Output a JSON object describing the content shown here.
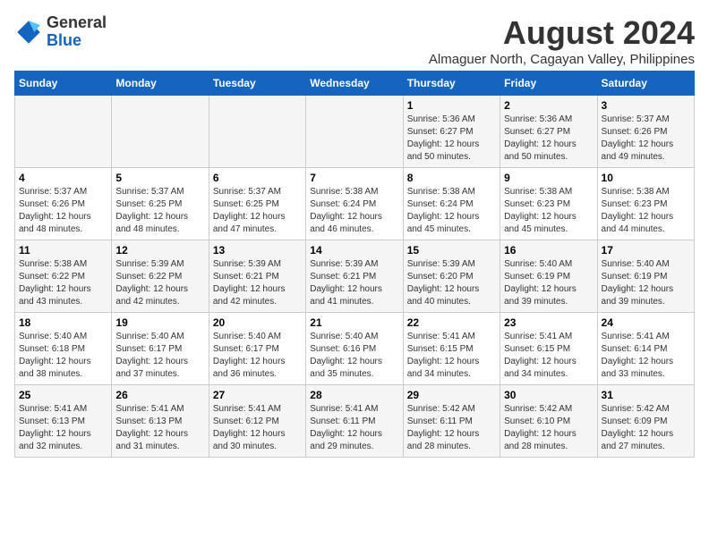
{
  "header": {
    "logo_general": "General",
    "logo_blue": "Blue",
    "main_title": "August 2024",
    "subtitle": "Almaguer North, Cagayan Valley, Philippines"
  },
  "days_of_week": [
    "Sunday",
    "Monday",
    "Tuesday",
    "Wednesday",
    "Thursday",
    "Friday",
    "Saturday"
  ],
  "weeks": [
    [
      {
        "day": "",
        "sunrise": "",
        "sunset": "",
        "daylight": ""
      },
      {
        "day": "",
        "sunrise": "",
        "sunset": "",
        "daylight": ""
      },
      {
        "day": "",
        "sunrise": "",
        "sunset": "",
        "daylight": ""
      },
      {
        "day": "",
        "sunrise": "",
        "sunset": "",
        "daylight": ""
      },
      {
        "day": "1",
        "sunrise": "Sunrise: 5:36 AM",
        "sunset": "Sunset: 6:27 PM",
        "daylight": "Daylight: 12 hours and 50 minutes."
      },
      {
        "day": "2",
        "sunrise": "Sunrise: 5:36 AM",
        "sunset": "Sunset: 6:27 PM",
        "daylight": "Daylight: 12 hours and 50 minutes."
      },
      {
        "day": "3",
        "sunrise": "Sunrise: 5:37 AM",
        "sunset": "Sunset: 6:26 PM",
        "daylight": "Daylight: 12 hours and 49 minutes."
      }
    ],
    [
      {
        "day": "4",
        "sunrise": "Sunrise: 5:37 AM",
        "sunset": "Sunset: 6:26 PM",
        "daylight": "Daylight: 12 hours and 48 minutes."
      },
      {
        "day": "5",
        "sunrise": "Sunrise: 5:37 AM",
        "sunset": "Sunset: 6:25 PM",
        "daylight": "Daylight: 12 hours and 48 minutes."
      },
      {
        "day": "6",
        "sunrise": "Sunrise: 5:37 AM",
        "sunset": "Sunset: 6:25 PM",
        "daylight": "Daylight: 12 hours and 47 minutes."
      },
      {
        "day": "7",
        "sunrise": "Sunrise: 5:38 AM",
        "sunset": "Sunset: 6:24 PM",
        "daylight": "Daylight: 12 hours and 46 minutes."
      },
      {
        "day": "8",
        "sunrise": "Sunrise: 5:38 AM",
        "sunset": "Sunset: 6:24 PM",
        "daylight": "Daylight: 12 hours and 45 minutes."
      },
      {
        "day": "9",
        "sunrise": "Sunrise: 5:38 AM",
        "sunset": "Sunset: 6:23 PM",
        "daylight": "Daylight: 12 hours and 45 minutes."
      },
      {
        "day": "10",
        "sunrise": "Sunrise: 5:38 AM",
        "sunset": "Sunset: 6:23 PM",
        "daylight": "Daylight: 12 hours and 44 minutes."
      }
    ],
    [
      {
        "day": "11",
        "sunrise": "Sunrise: 5:38 AM",
        "sunset": "Sunset: 6:22 PM",
        "daylight": "Daylight: 12 hours and 43 minutes."
      },
      {
        "day": "12",
        "sunrise": "Sunrise: 5:39 AM",
        "sunset": "Sunset: 6:22 PM",
        "daylight": "Daylight: 12 hours and 42 minutes."
      },
      {
        "day": "13",
        "sunrise": "Sunrise: 5:39 AM",
        "sunset": "Sunset: 6:21 PM",
        "daylight": "Daylight: 12 hours and 42 minutes."
      },
      {
        "day": "14",
        "sunrise": "Sunrise: 5:39 AM",
        "sunset": "Sunset: 6:21 PM",
        "daylight": "Daylight: 12 hours and 41 minutes."
      },
      {
        "day": "15",
        "sunrise": "Sunrise: 5:39 AM",
        "sunset": "Sunset: 6:20 PM",
        "daylight": "Daylight: 12 hours and 40 minutes."
      },
      {
        "day": "16",
        "sunrise": "Sunrise: 5:40 AM",
        "sunset": "Sunset: 6:19 PM",
        "daylight": "Daylight: 12 hours and 39 minutes."
      },
      {
        "day": "17",
        "sunrise": "Sunrise: 5:40 AM",
        "sunset": "Sunset: 6:19 PM",
        "daylight": "Daylight: 12 hours and 39 minutes."
      }
    ],
    [
      {
        "day": "18",
        "sunrise": "Sunrise: 5:40 AM",
        "sunset": "Sunset: 6:18 PM",
        "daylight": "Daylight: 12 hours and 38 minutes."
      },
      {
        "day": "19",
        "sunrise": "Sunrise: 5:40 AM",
        "sunset": "Sunset: 6:17 PM",
        "daylight": "Daylight: 12 hours and 37 minutes."
      },
      {
        "day": "20",
        "sunrise": "Sunrise: 5:40 AM",
        "sunset": "Sunset: 6:17 PM",
        "daylight": "Daylight: 12 hours and 36 minutes."
      },
      {
        "day": "21",
        "sunrise": "Sunrise: 5:40 AM",
        "sunset": "Sunset: 6:16 PM",
        "daylight": "Daylight: 12 hours and 35 minutes."
      },
      {
        "day": "22",
        "sunrise": "Sunrise: 5:41 AM",
        "sunset": "Sunset: 6:15 PM",
        "daylight": "Daylight: 12 hours and 34 minutes."
      },
      {
        "day": "23",
        "sunrise": "Sunrise: 5:41 AM",
        "sunset": "Sunset: 6:15 PM",
        "daylight": "Daylight: 12 hours and 34 minutes."
      },
      {
        "day": "24",
        "sunrise": "Sunrise: 5:41 AM",
        "sunset": "Sunset: 6:14 PM",
        "daylight": "Daylight: 12 hours and 33 minutes."
      }
    ],
    [
      {
        "day": "25",
        "sunrise": "Sunrise: 5:41 AM",
        "sunset": "Sunset: 6:13 PM",
        "daylight": "Daylight: 12 hours and 32 minutes."
      },
      {
        "day": "26",
        "sunrise": "Sunrise: 5:41 AM",
        "sunset": "Sunset: 6:13 PM",
        "daylight": "Daylight: 12 hours and 31 minutes."
      },
      {
        "day": "27",
        "sunrise": "Sunrise: 5:41 AM",
        "sunset": "Sunset: 6:12 PM",
        "daylight": "Daylight: 12 hours and 30 minutes."
      },
      {
        "day": "28",
        "sunrise": "Sunrise: 5:41 AM",
        "sunset": "Sunset: 6:11 PM",
        "daylight": "Daylight: 12 hours and 29 minutes."
      },
      {
        "day": "29",
        "sunrise": "Sunrise: 5:42 AM",
        "sunset": "Sunset: 6:11 PM",
        "daylight": "Daylight: 12 hours and 28 minutes."
      },
      {
        "day": "30",
        "sunrise": "Sunrise: 5:42 AM",
        "sunset": "Sunset: 6:10 PM",
        "daylight": "Daylight: 12 hours and 28 minutes."
      },
      {
        "day": "31",
        "sunrise": "Sunrise: 5:42 AM",
        "sunset": "Sunset: 6:09 PM",
        "daylight": "Daylight: 12 hours and 27 minutes."
      }
    ]
  ]
}
